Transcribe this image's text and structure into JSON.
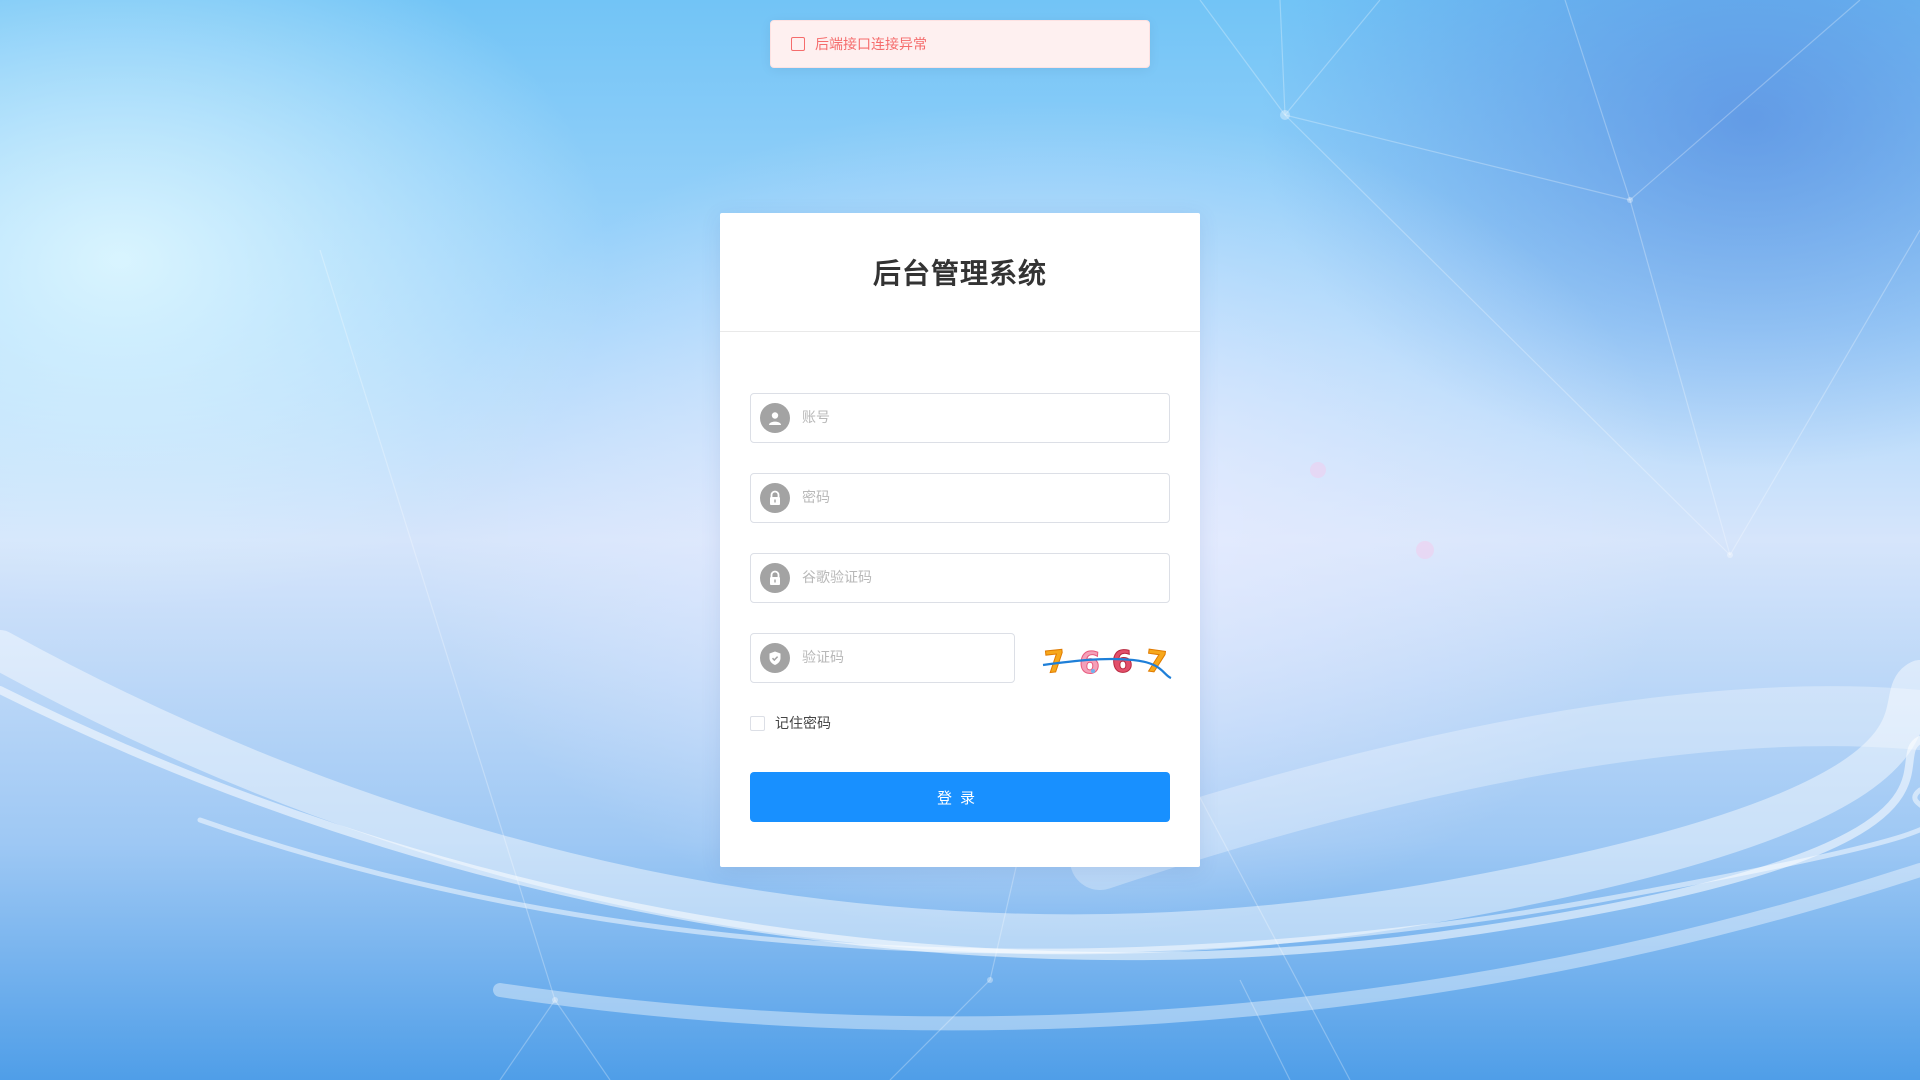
{
  "toast": {
    "message": "后端接口连接异常",
    "icon": "error-icon",
    "color": "#f56c6c"
  },
  "login": {
    "title": "后台管理系统",
    "username_placeholder": "账号",
    "password_placeholder": "密码",
    "google_code_placeholder": "谷歌验证码",
    "captcha_placeholder": "验证码",
    "captcha_text": "7667",
    "remember_label": "记住密码",
    "submit_label": "登录",
    "accent_color": "#1890ff"
  }
}
